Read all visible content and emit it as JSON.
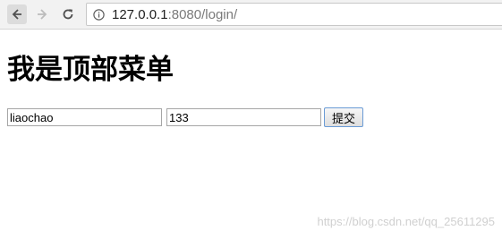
{
  "browser": {
    "url_host": "127.0.0.1",
    "url_rest": ":8080/login/",
    "icons": {
      "back": "arrow-left-icon",
      "forward": "arrow-right-icon",
      "reload": "reload-icon",
      "info": "info-icon"
    }
  },
  "page": {
    "title": "我是顶部菜单"
  },
  "form": {
    "username_value": "liaochao",
    "password_value": "133",
    "submit_label": "提交"
  },
  "watermark": {
    "text": "https://blog.csdn.net/qq_25611295"
  },
  "colors": {
    "button_border": "#6a9bd6",
    "address_border": "#c8c8c8"
  }
}
